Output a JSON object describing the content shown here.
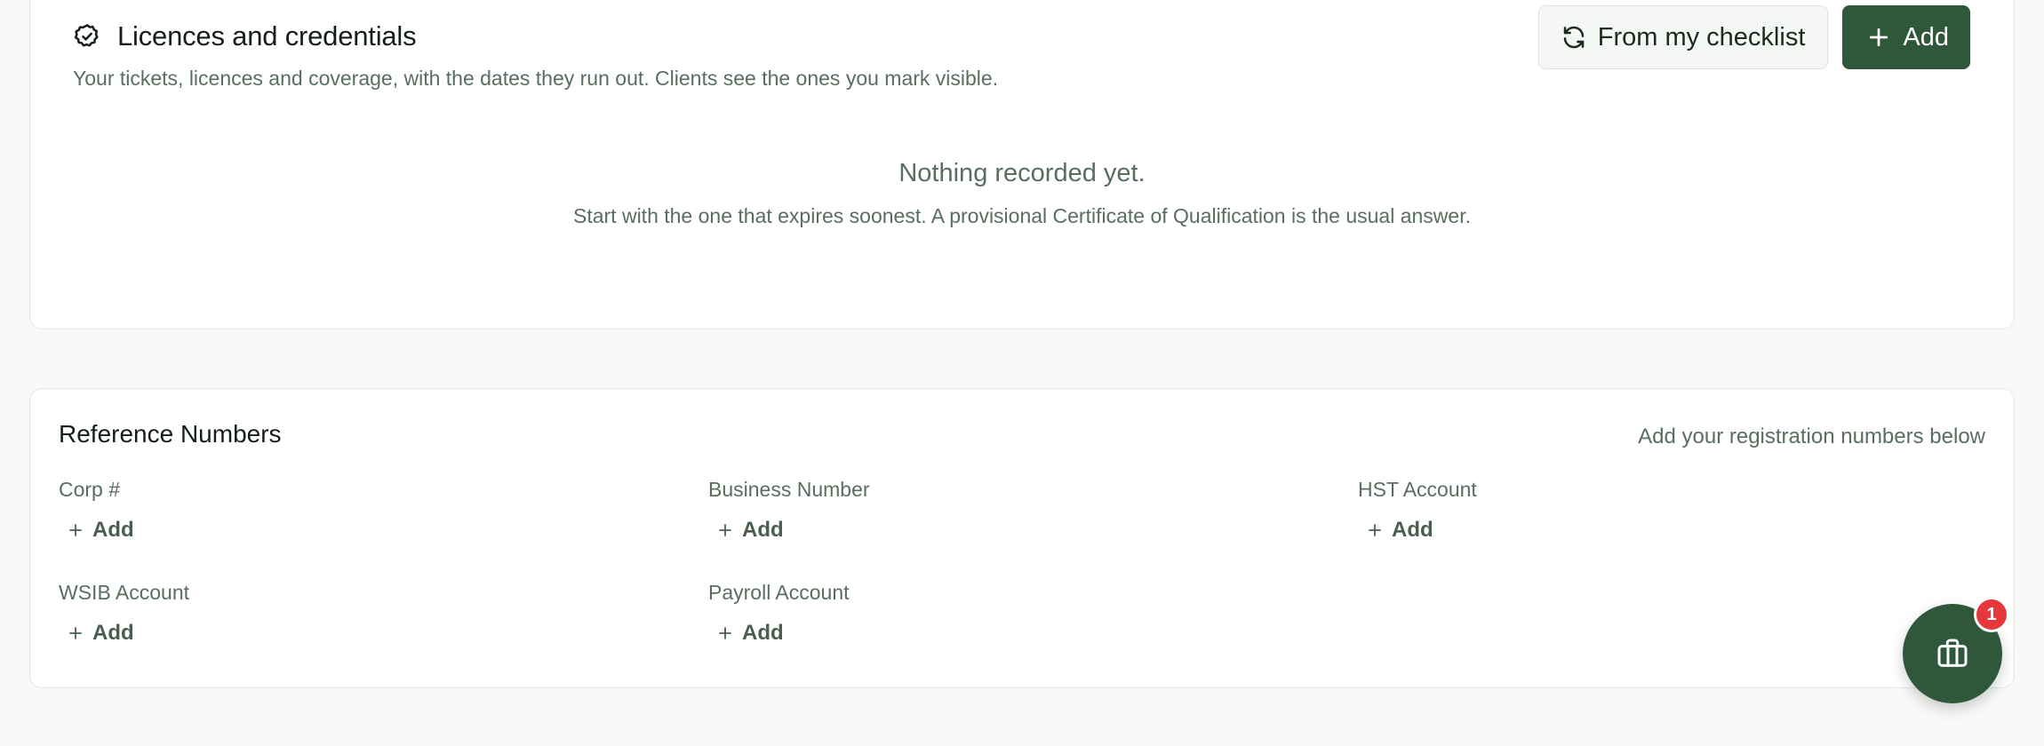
{
  "licences": {
    "title": "Licences and credentials",
    "title_icon": "badge-check-icon",
    "description": "Your tickets, licences and coverage, with the dates they run out. Clients see the ones you mark visible.",
    "checklist_button": {
      "label": "From my checklist",
      "icon": "refresh-icon"
    },
    "add_button": {
      "label": "Add",
      "icon": "plus-icon"
    },
    "empty_state": {
      "title": "Nothing recorded yet.",
      "subtitle": "Start with the one that expires soonest. A provisional Certificate of Qualification is the usual answer."
    }
  },
  "reference_numbers": {
    "title": "Reference Numbers",
    "hint": "Add your registration numbers below",
    "fields": [
      {
        "label": "Corp #",
        "action": "Add"
      },
      {
        "label": "Business Number",
        "action": "Add"
      },
      {
        "label": "HST Account",
        "action": "Add"
      },
      {
        "label": "WSIB Account",
        "action": "Add"
      },
      {
        "label": "Payroll Account",
        "action": "Add"
      }
    ]
  },
  "fab": {
    "icon": "briefcase-icon",
    "badge_count": "1"
  },
  "colors": {
    "primary": "#2f573a",
    "badge": "#e5383b",
    "muted_text": "#5a6e60",
    "page_background": "#f8faf8"
  }
}
